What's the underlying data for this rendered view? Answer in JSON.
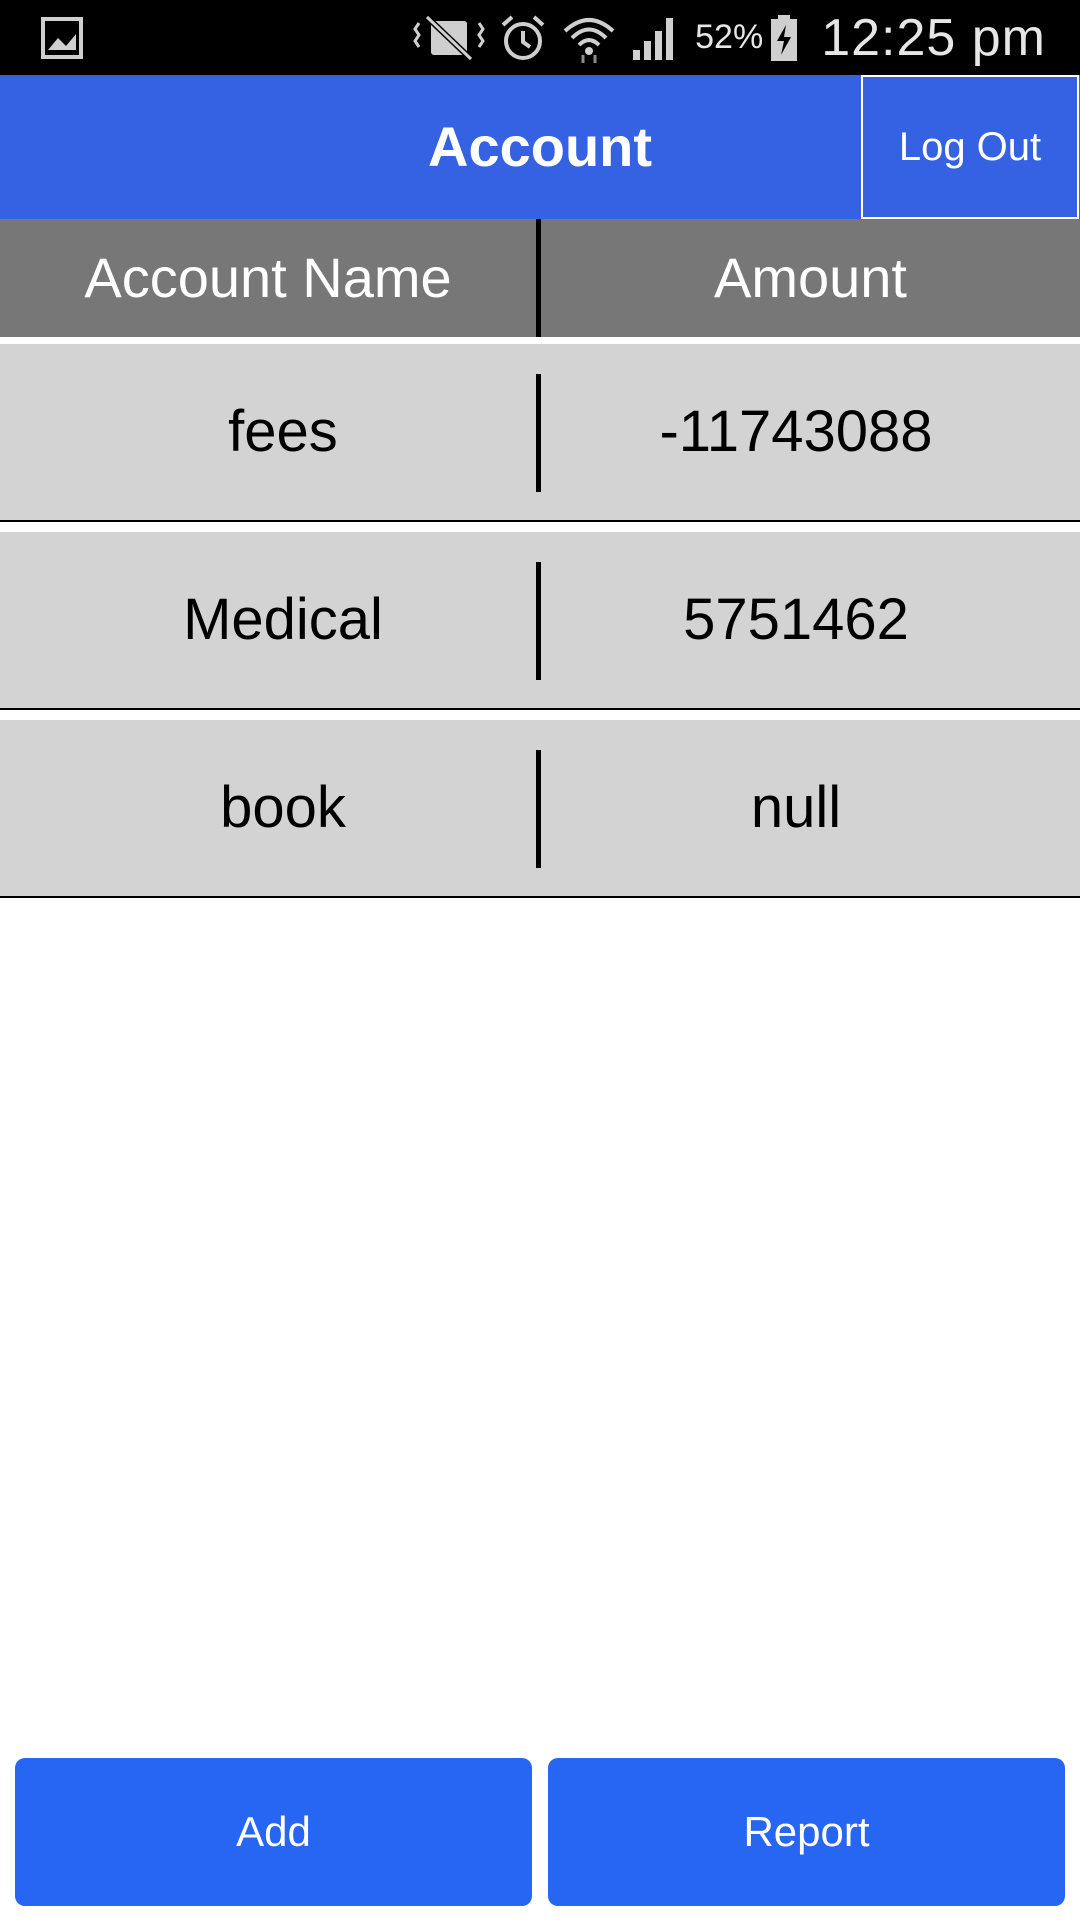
{
  "status_bar": {
    "battery_percent": "52%",
    "time": "12:25 pm",
    "icons": [
      "gallery-icon",
      "vibrate-icon",
      "alarm-icon",
      "wifi-icon",
      "signal-icon",
      "battery-charging-icon"
    ]
  },
  "header": {
    "title": "Account",
    "logout_label": "Log Out",
    "color": "#3562e3"
  },
  "table": {
    "columns": [
      "Account Name",
      "Amount"
    ],
    "rows": [
      {
        "name": "fees",
        "amount": "-11743088"
      },
      {
        "name": "Medical",
        "amount": "5751462"
      },
      {
        "name": "book",
        "amount": "null"
      }
    ]
  },
  "footer": {
    "add_label": "Add",
    "report_label": "Report",
    "button_color": "#2766f2"
  }
}
